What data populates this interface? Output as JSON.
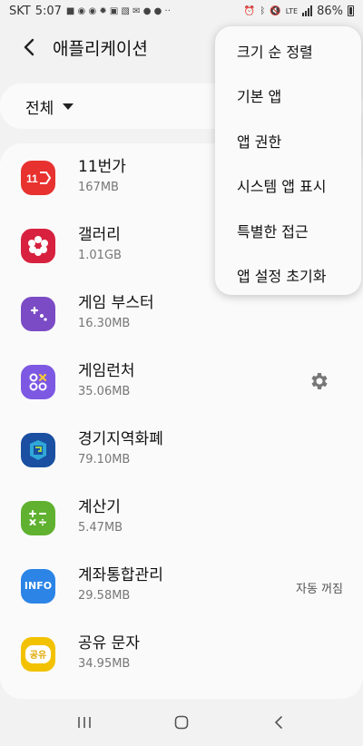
{
  "status_bar": {
    "carrier": "SKT",
    "time": "5:07",
    "network": "LTE",
    "battery": "86%"
  },
  "header": {
    "title": "애플리케이션"
  },
  "filter": {
    "label": "전체"
  },
  "apps": [
    {
      "name": "11번가",
      "size": "167MB",
      "icon": "11st-icon",
      "color": "#e8322f",
      "icon_text": "11"
    },
    {
      "name": "갤러리",
      "size": "1.01GB",
      "icon": "gallery-flower-icon",
      "color": "#d7213e"
    },
    {
      "name": "게임 부스터",
      "size": "16.30MB",
      "icon": "game-booster-icon",
      "color": "#7b4bc5"
    },
    {
      "name": "게임런처",
      "size": "35.06MB",
      "icon": "game-launcher-icon",
      "color": "#7c58e3",
      "has_settings": true
    },
    {
      "name": "경기지역화폐",
      "size": "79.10MB",
      "icon": "gyeonggi-currency-icon",
      "color": "#1a4fa1"
    },
    {
      "name": "계산기",
      "size": "5.47MB",
      "icon": "calculator-icon",
      "color": "#5fb12f"
    },
    {
      "name": "계좌통합관리",
      "size": "29.58MB",
      "icon": "account-info-icon",
      "color": "#2b84e6",
      "icon_text": "INFO",
      "status": "자동 꺼짐"
    },
    {
      "name": "공유 문자",
      "size": "34.95MB",
      "icon": "share-message-icon",
      "color": "#f2c200",
      "icon_text": "공유"
    }
  ],
  "menu": {
    "items": [
      "크기 순 정렬",
      "기본 앱",
      "앱 권한",
      "시스템 앱 표시",
      "특별한 접근",
      "앱 설정 초기화"
    ]
  }
}
